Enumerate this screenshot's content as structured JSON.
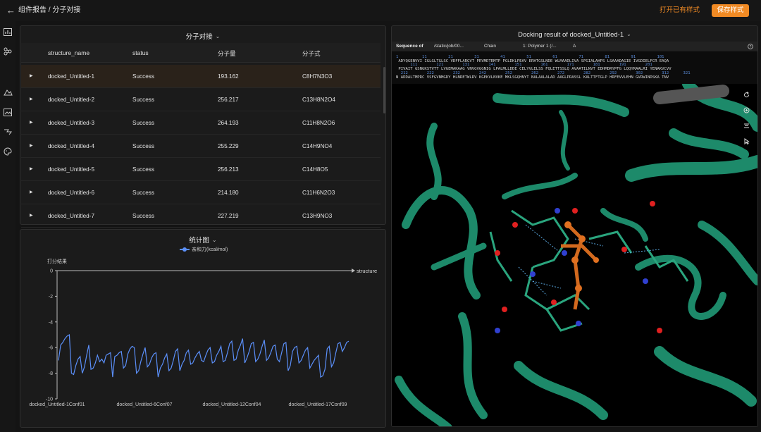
{
  "header": {
    "back_icon": "arrow-left-icon",
    "breadcrumb": "组件报告 / 分子对接",
    "open_style": "打开已有样式",
    "save_style": "保存样式",
    "accent": "#f08a24"
  },
  "nav_icons": [
    "chart-icon",
    "molecule-icon",
    "mountain-icon",
    "image-icon",
    "pipeline-icon",
    "palette-icon"
  ],
  "table_panel": {
    "title": "分子对接",
    "columns": [
      "structure_name",
      "status",
      "分子量",
      "分子式"
    ],
    "rows": [
      {
        "name": "docked_Untitled-1",
        "status": "Success",
        "mw": "193.162",
        "formula": "C8H7N3O3"
      },
      {
        "name": "docked_Untitled-2",
        "status": "Success",
        "mw": "256.217",
        "formula": "C13H8N2O4"
      },
      {
        "name": "docked_Untitled-3",
        "status": "Success",
        "mw": "264.193",
        "formula": "C11H8N2O6"
      },
      {
        "name": "docked_Untitled-4",
        "status": "Success",
        "mw": "255.229",
        "formula": "C14H9NO4"
      },
      {
        "name": "docked_Untitled-5",
        "status": "Success",
        "mw": "256.213",
        "formula": "C14H8O5"
      },
      {
        "name": "docked_Untitled-6",
        "status": "Success",
        "mw": "214.180",
        "formula": "C11H6N2O3"
      },
      {
        "name": "docked_Untitled-7",
        "status": "Success",
        "mw": "227.219",
        "formula": "C13H9NO3"
      }
    ]
  },
  "chart_panel": {
    "title": "统计图"
  },
  "chart_data": {
    "type": "line",
    "legend": "亲和力(kcal/mol)",
    "ylabel": "打分结果",
    "xlabel": "structure",
    "ylim": [
      -10,
      0
    ],
    "yticks": [
      0,
      -2,
      -4,
      -6,
      -8,
      -10
    ],
    "xtick_labels": [
      "docked_Untitled-1Conf01",
      "docked_Untitled-6Conf07",
      "docked_Untitled-12Conf04",
      "docked_Untitled-17Conf09"
    ],
    "series_color": "#5b8ff9",
    "values": [
      -7.0,
      -5.8,
      -5.6,
      -5.3,
      -5.1,
      -5.0,
      -8.0,
      -8.1,
      -7.4,
      -6.9,
      -6.7,
      -8.0,
      -7.5,
      -6.6,
      -5.8,
      -7.7,
      -7.6,
      -7.2,
      -6.6,
      -7.1,
      -6.9,
      -7.2,
      -6.6,
      -6.5,
      -6.4,
      -8.3,
      -6.7,
      -6.6,
      -6.4,
      -6.3,
      -7.6,
      -7.4,
      -6.5,
      -6.1,
      -5.9,
      -6.0,
      -8.0,
      -7.8,
      -7.1,
      -6.5,
      -6.0,
      -7.5,
      -7.3,
      -6.8,
      -6.5,
      -6.4,
      -8.3,
      -7.6,
      -7.3,
      -6.8,
      -6.5,
      -7.8,
      -7.6,
      -7.0,
      -6.3,
      -6.1,
      -7.8,
      -7.3,
      -7.0,
      -6.4,
      -6.2,
      -7.3,
      -7.2,
      -6.8,
      -6.5,
      -6.3,
      -7.0,
      -7.1,
      -6.6,
      -6.2,
      -6.0,
      -7.2,
      -7.1,
      -6.6,
      -6.3,
      -5.9,
      -7.1,
      -7.0,
      -6.4,
      -5.7,
      -5.5,
      -7.0,
      -6.9,
      -6.2,
      -5.8,
      -5.3,
      -7.2,
      -6.8,
      -6.3,
      -5.7,
      -5.6,
      -7.1,
      -6.9,
      -6.5,
      -5.9,
      -5.4,
      -7.0,
      -6.8,
      -6.4,
      -5.9,
      -5.8,
      -6.9,
      -7.1,
      -6.4,
      -5.7,
      -5.6,
      -7.8,
      -7.4,
      -6.3,
      -6.0,
      -5.9,
      -7.2,
      -7.0,
      -6.6,
      -6.2,
      -6.0,
      -7.6,
      -7.3,
      -7.0,
      -6.8,
      -6.6,
      -8.3,
      -8.2,
      -7.7,
      -6.1,
      -5.9,
      -7.5,
      -7.2,
      -6.4,
      -5.7,
      -5.6,
      -6.3,
      -6.0,
      -5.6,
      -5.5
    ]
  },
  "viewer": {
    "title": "Docking result of docked_Untitled-1",
    "seq_label": "Sequence of",
    "seq_path": "/static/job/00...",
    "chain_label": "Chain",
    "polymer": "1: Polymer 1 (/...",
    "chain_id": "A",
    "help_icon": "help-icon",
    "seq_lines": [
      {
        "nums": "1          11         21         31         41         51         61         71         81         91         101",
        "res": " ADYQGENVVI IGLGLTGLSC VDFFLARGVT PRVMDTRMTP PGLDKLPEAV ERHTGSLNDE WLMAADLIVA SPGIALAHPS LSAAADAGIE IVGDIELFCR EAQA"
      },
      {
        "nums": "      111        121        131        141        151        161        171        181        191        201",
        "res": " PIVAIT GSNGKSTVTT LVGEMAKAAG VNVGVGGNIG LPALMLLDDE CELYVLELSS FQLETTSSLQ AVAATILNVT EDHMDRYPFG LQQYRAALRI YENAKVCVV"
      },
      {
        "nums": "  212        222        232        242        252        262        272        282        292        302        312      321",
        "res": "N ADDALTMPRC VSFGVNMGDY HLNRETWLRV KGEKVLNVKE MKLSGQHNYT NALAALALAD AAGLPRASSL KALTTFTGLP HRFEVVLEHN GVRWINDSKA TNV"
      }
    ],
    "tool_icons": [
      "rotate-icon",
      "zoom-icon",
      "sequence-icon",
      "cursor-icon"
    ]
  }
}
